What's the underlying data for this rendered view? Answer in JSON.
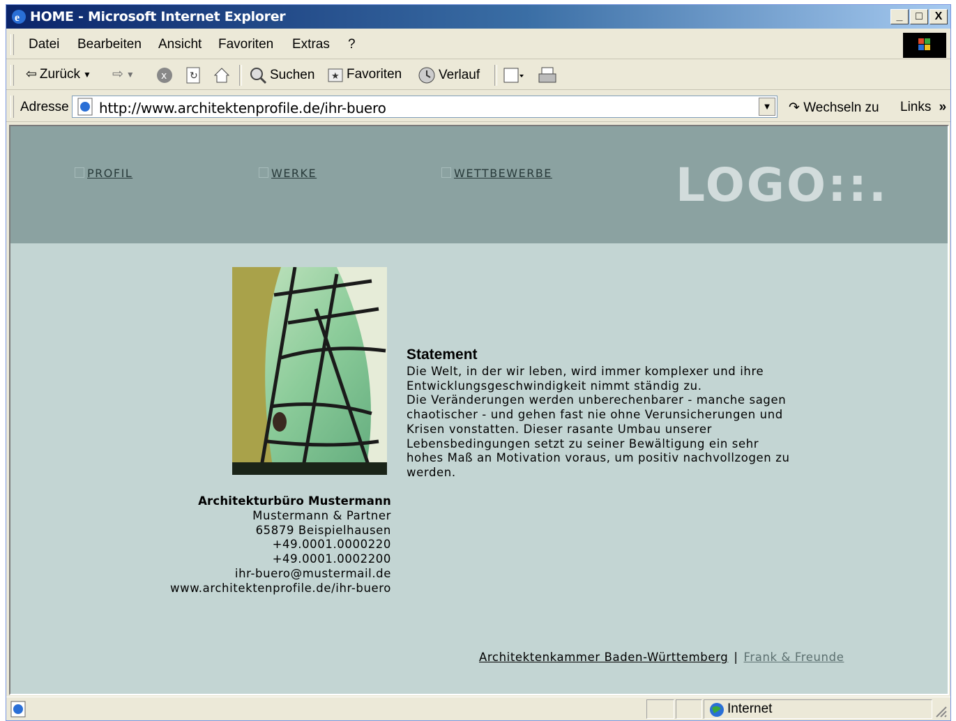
{
  "window": {
    "title": "HOME - Microsoft Internet Explorer"
  },
  "titlebar_buttons": {
    "minimize": "_",
    "maximize": "□",
    "close": "X"
  },
  "menu": [
    "Datei",
    "Bearbeiten",
    "Ansicht",
    "Favoriten",
    "Extras",
    "?"
  ],
  "toolbar": {
    "back": "Zurück",
    "search": "Suchen",
    "favorites": "Favoriten",
    "history": "Verlauf"
  },
  "address": {
    "label": "Adresse",
    "url": "http://www.architektenprofile.de/ihr-buero",
    "go": "Wechseln zu",
    "links": "Links"
  },
  "page": {
    "nav": [
      "PROFIL",
      "WERKE",
      "WETTBEWERBE"
    ],
    "logo": "LOGO::.",
    "statement_title": "Statement",
    "statement_text": "Die Welt, in der wir leben, wird immer komplexer und ihre\nEntwicklungsgeschwindigkeit nimmt ständig zu.\nDie Veränderungen werden unberechenbarer - manche sagen\nchaotischer - und gehen fast nie ohne Verunsicherungen und\nKrisen vonstatten. Dieser rasante Umbau unserer\nLebensbedingungen setzt zu seiner Bewältigung ein sehr\nhohes Maß an Motivation voraus, um positiv nachvollzogen zu\nwerden.",
    "contact": {
      "name": "Architekturbüro Mustermann",
      "partner": "Mustermann & Partner",
      "city": "65879 Beispielhausen",
      "phone": "+49.0001.0000220",
      "fax": "+49.0001.0002200",
      "email": "ihr-buero@mustermail.de",
      "web": "www.architektenprofile.de/ihr-buero"
    },
    "footer": {
      "link1": "Architektenkammer Baden-Württemberg",
      "separator": "|",
      "link2": "Frank & Freunde"
    }
  },
  "status": {
    "zone": "Internet"
  },
  "colors": {
    "header": "#8ba2a1",
    "content_bg": "#c3d5d3",
    "logo": "#d2dcdc",
    "titlebar": "#0a246a"
  }
}
